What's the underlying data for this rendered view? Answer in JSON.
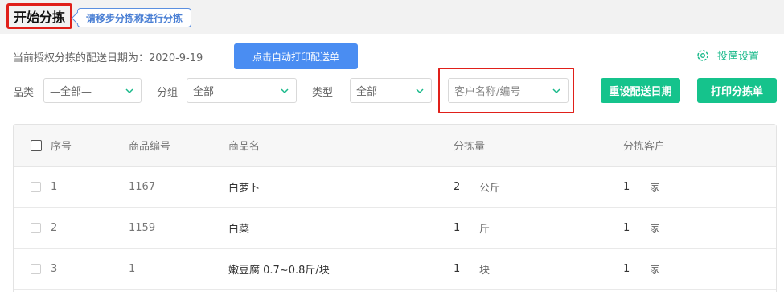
{
  "header": {
    "title": "开始分拣",
    "hint": "请移步分拣称进行分拣"
  },
  "toolbar": {
    "date_label": "当前授权分拣的配送日期为：2020-9-19",
    "auto_print_button": "点击自动打印配送单",
    "settings_label": "投筐设置"
  },
  "filters": {
    "category_label": "品类",
    "category_value": "—全部—",
    "group_label": "分组",
    "group_value": "全部",
    "type_label": "类型",
    "type_value": "全部",
    "customer_placeholder": "客户名称/编号",
    "reset_date_button": "重设配送日期",
    "print_sort_button": "打印分拣单"
  },
  "table": {
    "columns": [
      "序号",
      "商品编号",
      "商品名",
      "分拣量",
      "分拣客户"
    ],
    "rows": [
      {
        "index": "1",
        "code": "1167",
        "name": "白萝卜",
        "qty": "2",
        "qty_unit": "公斤",
        "customers": "1",
        "customers_unit": "家"
      },
      {
        "index": "2",
        "code": "1159",
        "name": "白菜",
        "qty": "1",
        "qty_unit": "斤",
        "customers": "1",
        "customers_unit": "家"
      },
      {
        "index": "3",
        "code": "1",
        "name": "嫩豆腐 0.7~0.8斤/块",
        "qty": "1",
        "qty_unit": "块",
        "customers": "1",
        "customers_unit": "家"
      }
    ]
  },
  "colors": {
    "accent_green": "#15c38c",
    "accent_blue": "#4a8df2",
    "highlight_red": "#e0201a"
  }
}
